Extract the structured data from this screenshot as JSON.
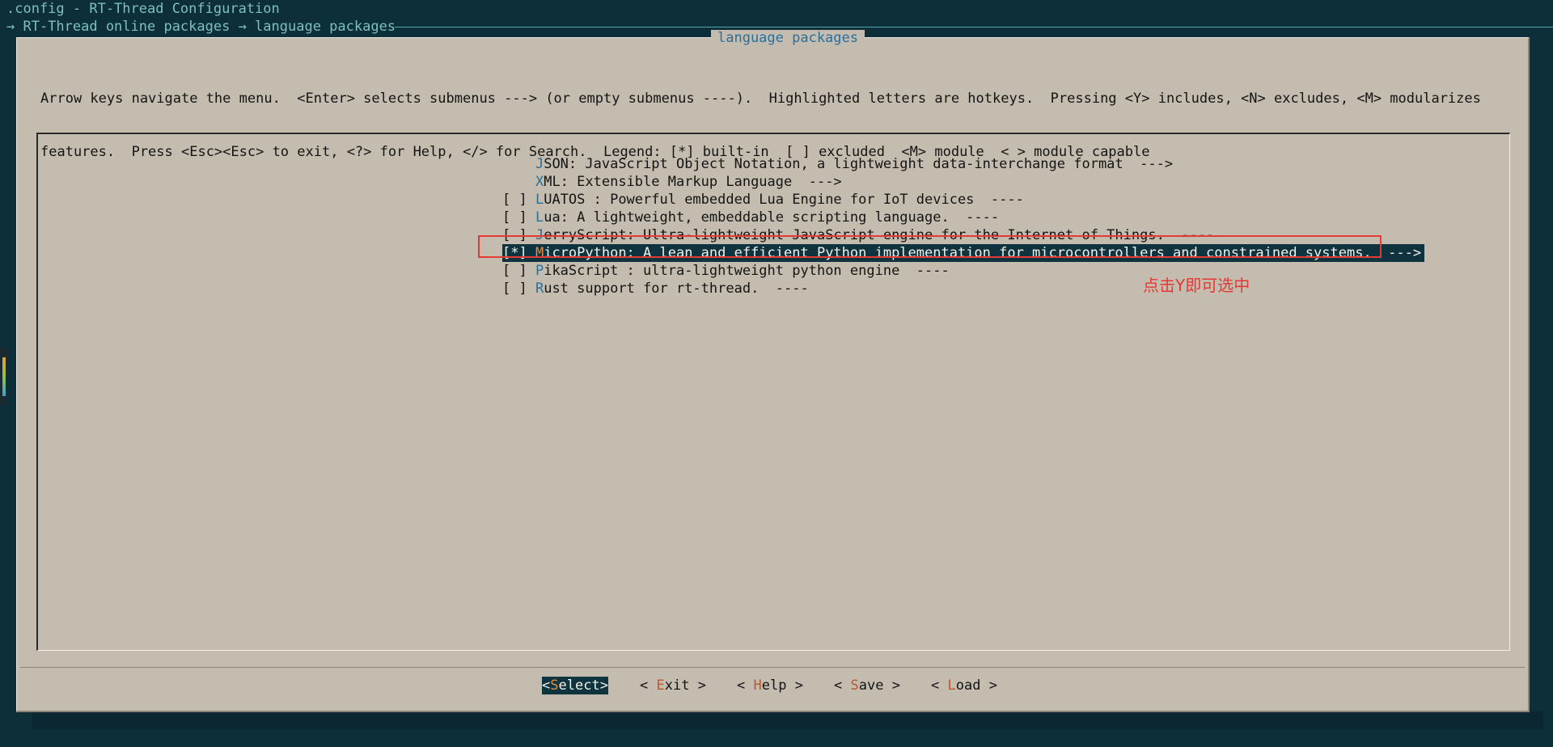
{
  "header": {
    "title_line": ".config - RT-Thread Configuration",
    "breadcrumb": "→ RT-Thread online packages → language packages"
  },
  "dialog": {
    "title": "language packages",
    "help_line1": "Arrow keys navigate the menu.  <Enter> selects submenus ---> (or empty submenus ----).  Highlighted letters are hotkeys.  Pressing <Y> includes, <N> excludes, <M> modularizes",
    "help_line2": "features.  Press <Esc><Esc> to exit, <?> for Help, </> for Search.  Legend: [*] built-in  [ ] excluded  <M> module  < > module capable"
  },
  "items": [
    {
      "prefix": "    ",
      "hot": "J",
      "rest": "SON: JavaScript Object Notation, a lightweight data-interchange format  --->"
    },
    {
      "prefix": "    ",
      "hot": "X",
      "rest": "ML: Extensible Markup Language  --->"
    },
    {
      "prefix": "[ ] ",
      "hot": "L",
      "rest": "UATOS : Powerful embedded Lua Engine for IoT devices  ----"
    },
    {
      "prefix": "[ ] ",
      "hot": "L",
      "rest": "ua: A lightweight, embeddable scripting language.  ----"
    },
    {
      "prefix": "[ ] ",
      "hot": "J",
      "rest": "erryScript: Ultra-lightweight JavaScript engine for the Internet of Things.  ----"
    },
    {
      "prefix": "[*] ",
      "hot": "M",
      "rest": "icroPython: A lean and efficient Python implementation for microcontrollers and constrained systems.  --->"
    },
    {
      "prefix": "[ ] ",
      "hot": "P",
      "rest": "ikaScript : ultra-lightweight python engine  ----"
    },
    {
      "prefix": "[ ] ",
      "hot": "R",
      "rest": "ust support for rt-thread.  ----"
    }
  ],
  "annotation": "点击Y即可选中",
  "buttons": {
    "select": {
      "open": "<",
      "hot": "S",
      "rest": "elect",
      "close": ">"
    },
    "exit": {
      "open": "< ",
      "hot": "E",
      "rest": "xit",
      "close": " >"
    },
    "help": {
      "open": "< ",
      "hot": "H",
      "rest": "elp",
      "close": " >"
    },
    "save": {
      "open": "< ",
      "hot": "S",
      "rest": "ave",
      "close": " >"
    },
    "load": {
      "open": "< ",
      "hot": "L",
      "rest": "oad",
      "close": " >"
    }
  },
  "colors": {
    "terminal_bg": "#0c2f3a",
    "dialog_bg": "#c4bcae",
    "selection_bg": "#0f3440",
    "hotkey": "#2b6f9b",
    "annotation_red": "#e53935"
  }
}
